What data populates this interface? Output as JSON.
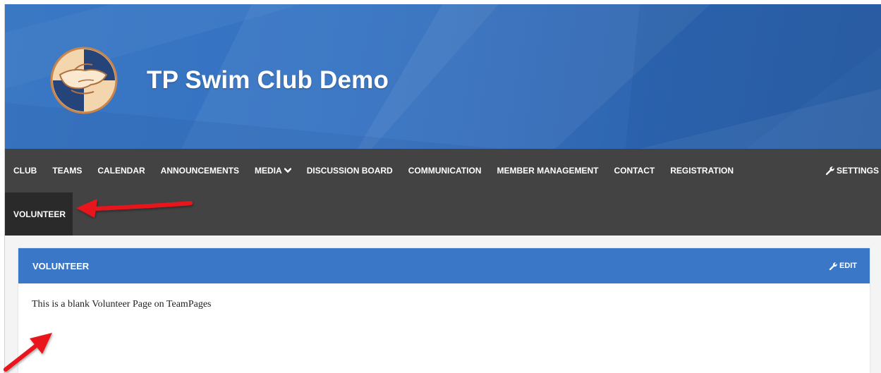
{
  "site": {
    "title": "TP Swim Club Demo",
    "logo_icon": "hands-together-logo"
  },
  "nav": {
    "items": [
      {
        "label": "CLUB"
      },
      {
        "label": "TEAMS"
      },
      {
        "label": "CALENDAR"
      },
      {
        "label": "ANNOUNCEMENTS"
      },
      {
        "label": "MEDIA",
        "icon": "chevron-down-icon"
      },
      {
        "label": "DISCUSSION BOARD"
      },
      {
        "label": "COMMUNICATION"
      },
      {
        "label": "MEMBER MANAGEMENT"
      },
      {
        "label": "CONTACT"
      },
      {
        "label": "REGISTRATION"
      }
    ],
    "settings_label": "SETTINGS",
    "settings_icon": "wrench-icon",
    "active_item": "VOLUNTEER"
  },
  "panel": {
    "title": "VOLUNTEER",
    "edit_label": "EDIT",
    "edit_icon": "wrench-icon",
    "body_text": "This is a blank Volunteer Page on TeamPages"
  },
  "colors": {
    "banner_blue": "#3472c2",
    "nav_bg": "#434343",
    "nav_active_bg": "#2a2a2a",
    "panel_header": "#3a77c6",
    "arrow_red": "#e8141c"
  }
}
